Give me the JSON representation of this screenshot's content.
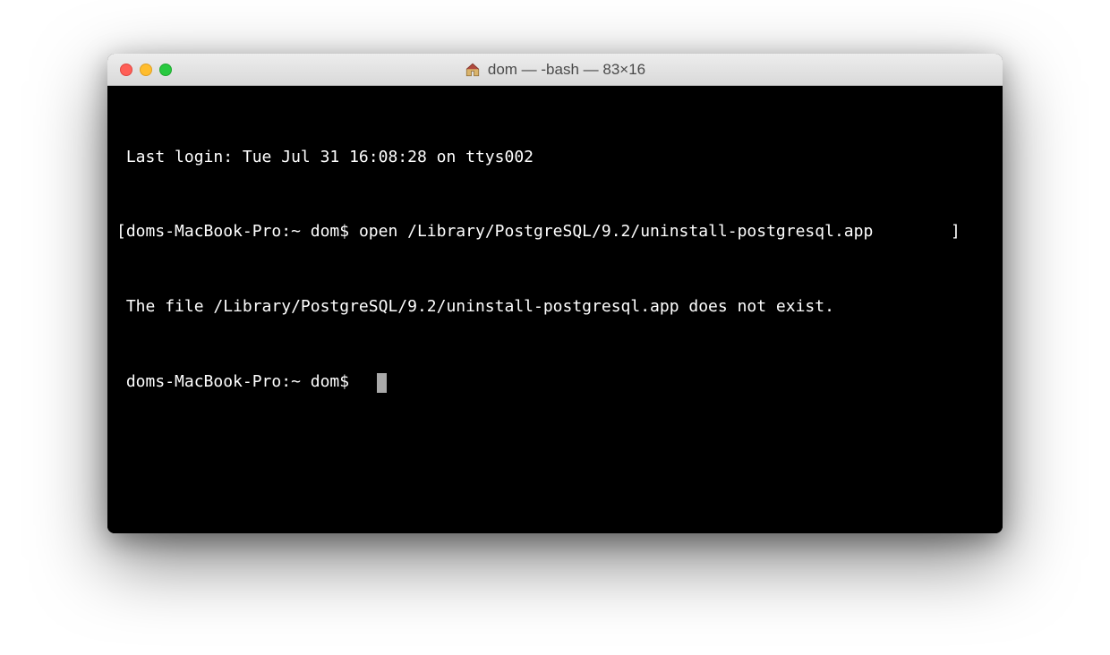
{
  "window": {
    "title": "dom — -bash — 83×16",
    "icon": "home-icon"
  },
  "traffic_lights": {
    "close": "close",
    "minimize": "minimize",
    "zoom": "zoom"
  },
  "terminal": {
    "lines": {
      "0": "Last login: Tue Jul 31 16:08:28 on ttys002",
      "1_left_bracket": "[",
      "1_prompt": "doms-MacBook-Pro:~ dom$ ",
      "1_command": "open /Library/PostgreSQL/9.2/uninstall-postgresql.app",
      "1_right_bracket": "]",
      "2": "The file /Library/PostgreSQL/9.2/uninstall-postgresql.app does not exist.",
      "3_prompt": "doms-MacBook-Pro:~ dom$ "
    }
  }
}
